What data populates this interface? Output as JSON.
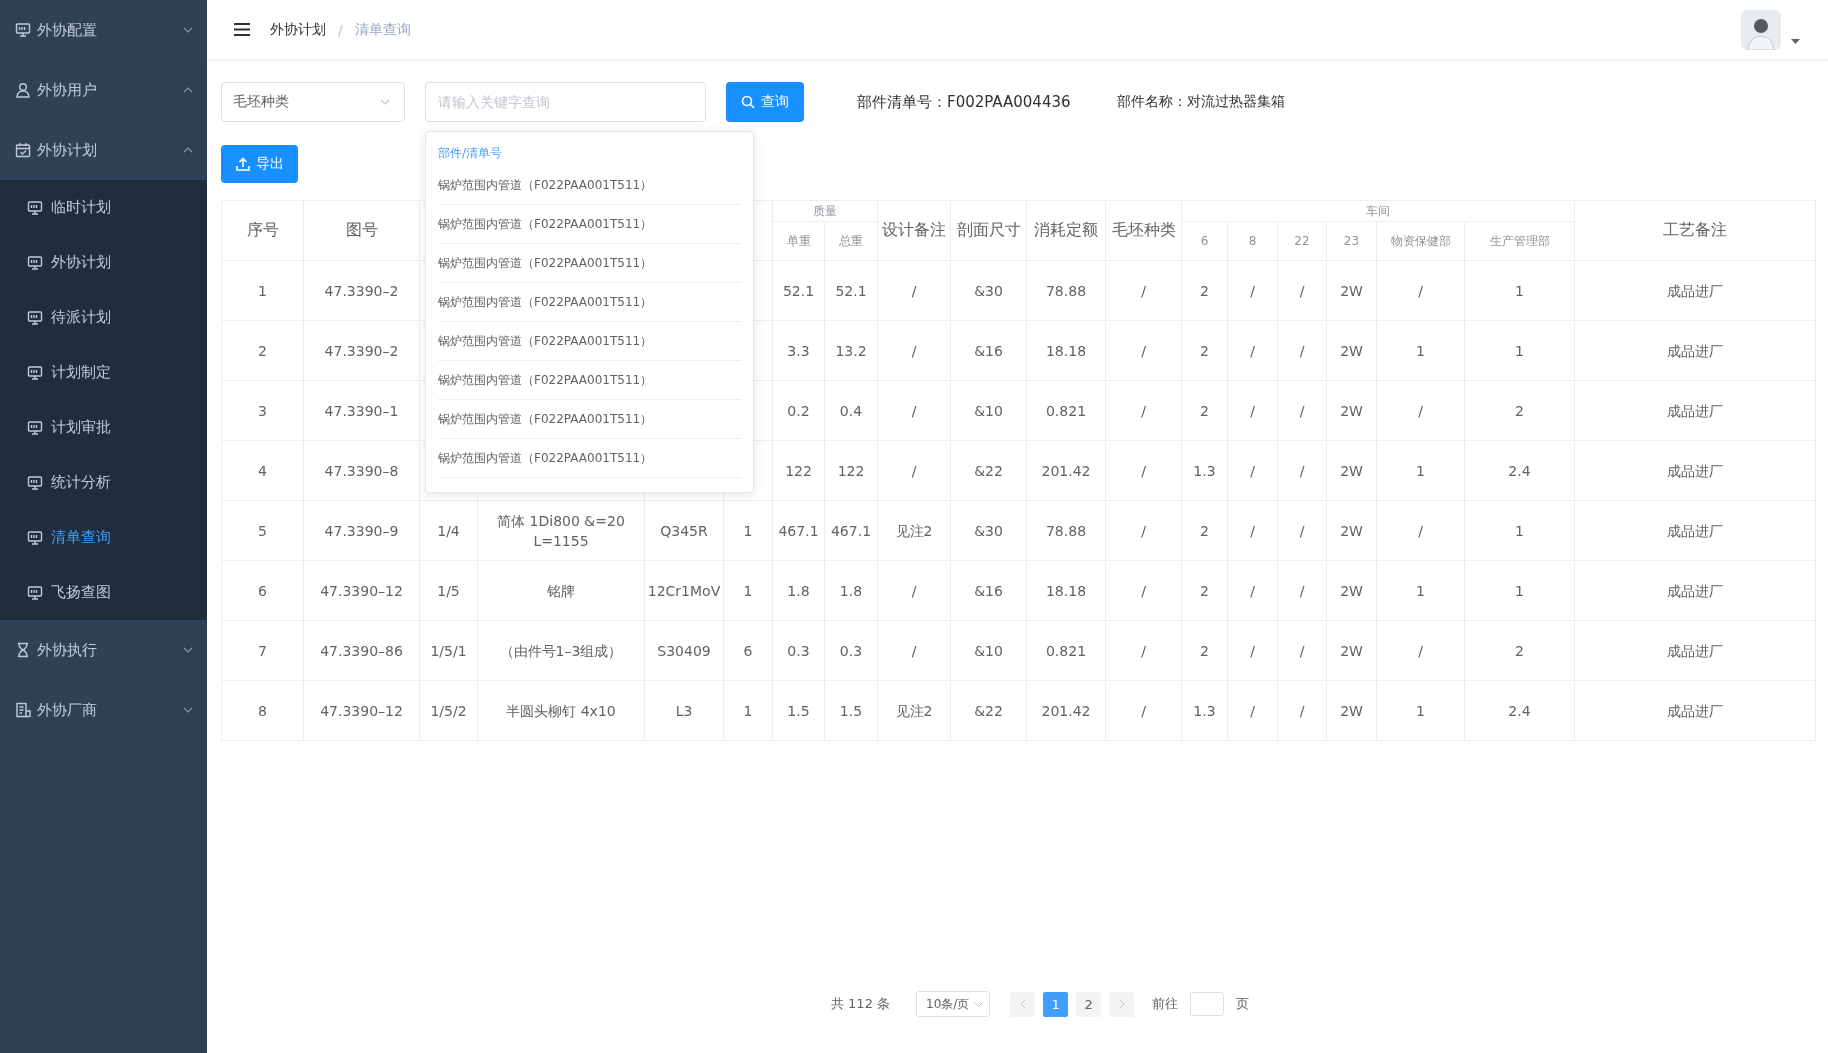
{
  "sidebar": {
    "items": [
      {
        "label": "外协配置",
        "expanded": false
      },
      {
        "label": "外协用户",
        "expanded": true
      },
      {
        "label": "外协计划",
        "expanded": true,
        "children": [
          {
            "label": "临时计划",
            "selected": false
          },
          {
            "label": "外协计划",
            "selected": false
          },
          {
            "label": "待派计划",
            "selected": false
          },
          {
            "label": "计划制定",
            "selected": false
          },
          {
            "label": "计划审批",
            "selected": false
          },
          {
            "label": "统计分析",
            "selected": false
          },
          {
            "label": "清单查询",
            "selected": true
          },
          {
            "label": "飞扬查图",
            "selected": false
          }
        ]
      },
      {
        "label": "外协执行",
        "expanded": false
      },
      {
        "label": "外协厂商",
        "expanded": false
      }
    ]
  },
  "breadcrumb": {
    "items": [
      "外协计划",
      "清单查询"
    ],
    "separator": "/"
  },
  "toolbar": {
    "select": {
      "value": "毛坯种类"
    },
    "search": {
      "placeholder": "请输入关键字查询"
    },
    "query_button": "查询",
    "part_list_no": "部件清单号：F002PAA004436",
    "part_name": "部件名称：对流过热器集箱",
    "export_button": "导出"
  },
  "suggestions": {
    "header": "部件/清单号",
    "items": [
      "锅炉范围内管道（F022PAA001T511）",
      "锅炉范围内管道（F022PAA001T511）",
      "锅炉范围内管道（F022PAA001T511）",
      "锅炉范围内管道（F022PAA001T511）",
      "锅炉范围内管道（F022PAA001T511）",
      "锅炉范围内管道（F022PAA001T511）",
      "锅炉范围内管道（F022PAA001T511）",
      "锅炉范围内管道（F022PAA001T511）"
    ]
  },
  "table": {
    "columns": [
      {
        "label": "序号"
      },
      {
        "label": "图号"
      },
      {},
      {},
      {},
      {},
      {
        "label": "单重",
        "group": "质量"
      },
      {
        "label": "总重",
        "in_group": true
      },
      {
        "label": "设计备注"
      },
      {
        "label": "剖面尺寸"
      },
      {
        "label": "消耗定额"
      },
      {
        "label": "毛坯种类"
      },
      {
        "label": "6",
        "group": "车间"
      },
      {
        "label": "8",
        "in_group": true
      },
      {
        "label": "22",
        "in_group": true
      },
      {
        "label": "23",
        "in_group": true
      },
      {
        "label": "物资保健部",
        "in_group": true
      },
      {
        "label": "生产管理部",
        "in_group": true
      },
      {
        "label": "工艺备注"
      }
    ],
    "rows": [
      [
        "1",
        "47.3390–2",
        null,
        null,
        null,
        null,
        "52.1",
        "52.1",
        "/",
        "&30",
        "78.88",
        "/",
        "2",
        "/",
        "/",
        "2W",
        "/",
        "1",
        "成品进厂"
      ],
      [
        "2",
        "47.3390–2",
        null,
        null,
        null,
        null,
        "3.3",
        "13.2",
        "/",
        "&16",
        "18.18",
        "/",
        "2",
        "/",
        "/",
        "2W",
        "1",
        "1",
        "成品进厂"
      ],
      [
        "3",
        "47.3390–1",
        null,
        null,
        null,
        null,
        "0.2",
        "0.4",
        "/",
        "&10",
        "0.821",
        "/",
        "2",
        "/",
        "/",
        "2W",
        "/",
        "2",
        "成品进厂"
      ],
      [
        "4",
        "47.3390–8",
        null,
        null,
        null,
        null,
        "122",
        "122",
        "/",
        "&22",
        "201.42",
        "/",
        "1.3",
        "/",
        "/",
        "2W",
        "1",
        "2.4",
        "成品进厂"
      ],
      [
        "5",
        "47.3390–9",
        "1/4",
        "简体 1Di800 &=20 L=1155",
        "Q345R",
        "1",
        "467.1",
        "467.1",
        "见注2",
        "&30",
        "78.88",
        "/",
        "2",
        "/",
        "/",
        "2W",
        "/",
        "1",
        "成品进厂"
      ],
      [
        "6",
        "47.3390–12",
        "1/5",
        "铭牌",
        "12Cr1MoV",
        "1",
        "1.8",
        "1.8",
        "/",
        "&16",
        "18.18",
        "/",
        "2",
        "/",
        "/",
        "2W",
        "1",
        "1",
        "成品进厂"
      ],
      [
        "7",
        "47.3390–86",
        "1/5/1",
        "（由件号1–3组成）",
        "S30409",
        "6",
        "0.3",
        "0.3",
        "/",
        "&10",
        "0.821",
        "/",
        "2",
        "/",
        "/",
        "2W",
        "/",
        "2",
        "成品进厂"
      ],
      [
        "8",
        "47.3390–12",
        "1/5/2",
        "半圆头柳钉 4x10",
        "L3",
        "1",
        "1.5",
        "1.5",
        "见注2",
        "&22",
        "201.42",
        "/",
        "1.3",
        "/",
        "/",
        "2W",
        "1",
        "2.4",
        "成品进厂"
      ]
    ]
  },
  "pagination": {
    "total": "共 112 条",
    "page_size": "10条/页",
    "pages": [
      {
        "label": "1",
        "selected": true
      },
      {
        "label": "2",
        "selected": false
      }
    ],
    "goto_label": "前往",
    "page_unit": "页"
  }
}
